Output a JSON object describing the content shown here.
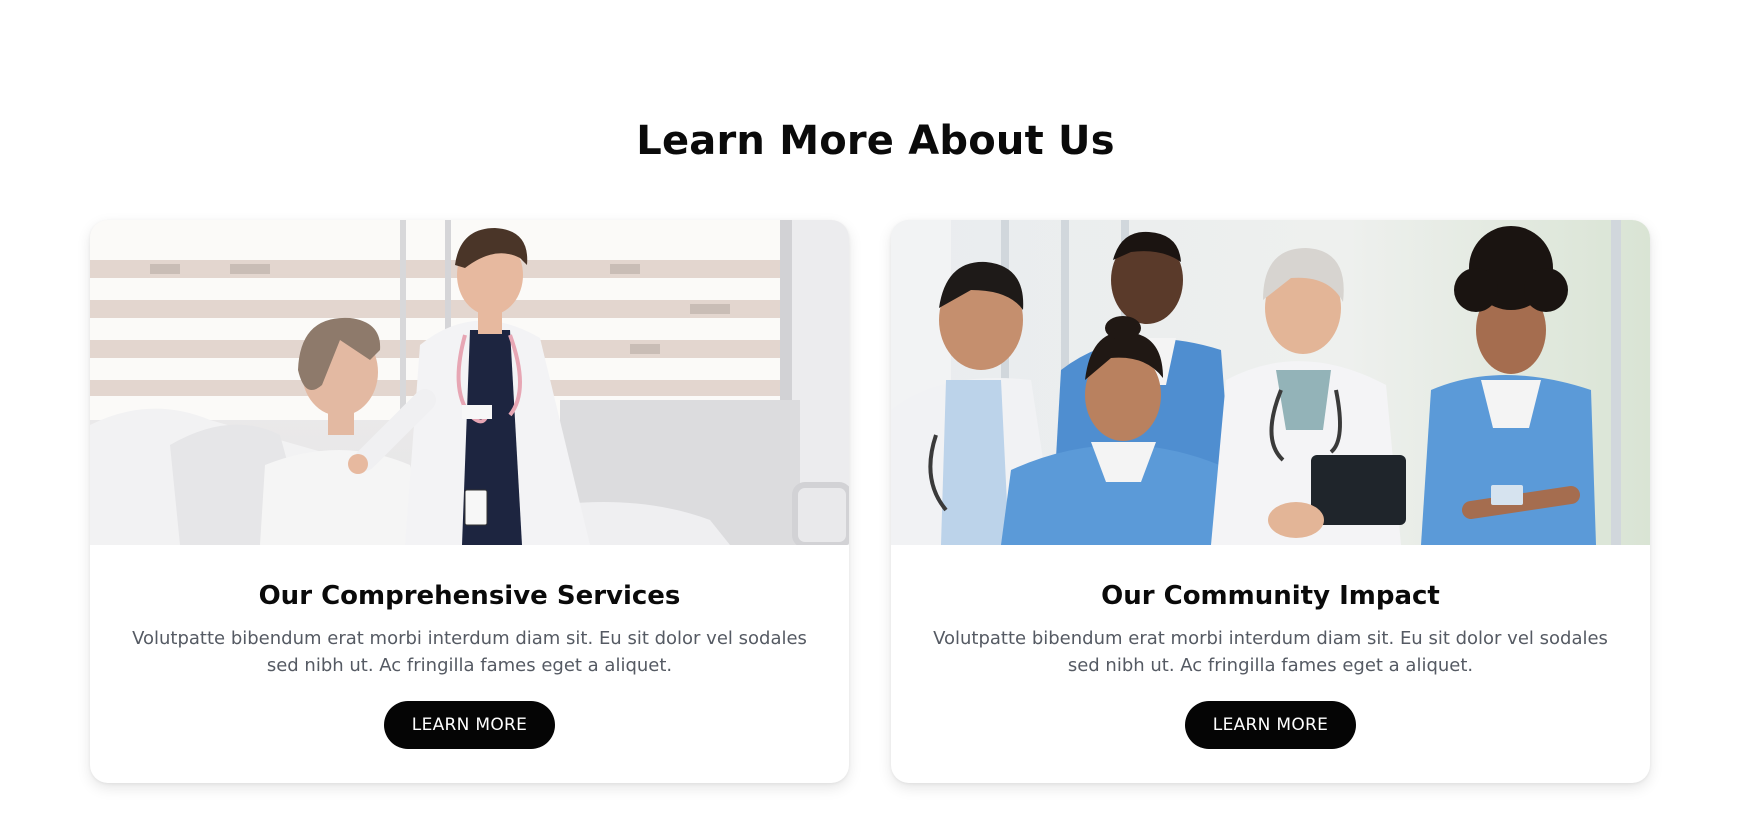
{
  "section": {
    "title": "Learn More About Us"
  },
  "cards": [
    {
      "image": "photo-doctor-with-patient",
      "title": "Our Comprehensive Services",
      "text": "Volutpatte bibendum erat morbi interdum diam sit. Eu sit dolor vel sodales sed nibh ut. Ac fringilla fames eget a aliquet.",
      "button_label": "LEARN MORE"
    },
    {
      "image": "photo-medical-team",
      "title": "Our Community Impact",
      "text": "Volutpatte bibendum erat morbi interdum diam sit. Eu sit dolor vel sodales sed nibh ut. Ac fringilla fames eget a aliquet.",
      "button_label": "LEARN MORE"
    }
  ],
  "colors": {
    "button_bg": "#050505",
    "button_text": "#ffffff",
    "body_text": "#555a63",
    "scrub_blue": "#4f93cf"
  }
}
